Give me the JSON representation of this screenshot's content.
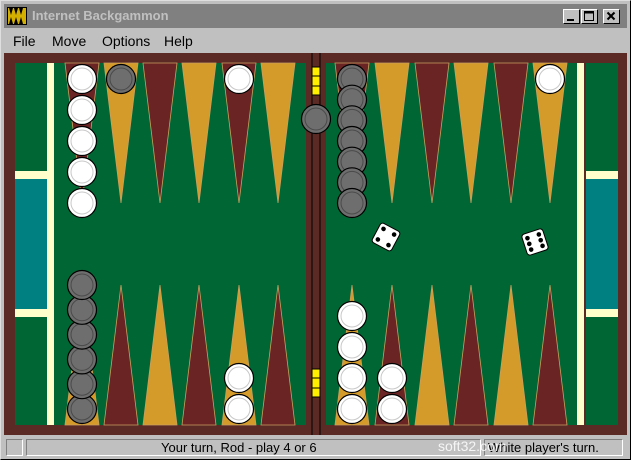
{
  "window": {
    "title": "Internet Backgammon",
    "controls": [
      "minimize",
      "maximize",
      "close"
    ]
  },
  "menu": [
    {
      "label": "File"
    },
    {
      "label": "Move"
    },
    {
      "label": "Options"
    },
    {
      "label": "Help"
    }
  ],
  "colors": {
    "felt": "#006633",
    "frame": "#5c2a25",
    "point_dark": "#6b2424",
    "point_light": "#d49a2a",
    "bear_off": "#008080",
    "bar": "#5c2a25",
    "white_checker": "#ffffff",
    "black_checker": "#6e6e6e",
    "trim": "#ffffcc"
  },
  "board": {
    "top_points": [
      {
        "white": 5,
        "black": 0
      },
      {
        "white": 0,
        "black": 1
      },
      {
        "white": 0,
        "black": 0
      },
      {
        "white": 0,
        "black": 0
      },
      {
        "white": 1,
        "black": 0
      },
      {
        "white": 0,
        "black": 0
      },
      {
        "white": 0,
        "black": 7
      },
      {
        "white": 0,
        "black": 0
      },
      {
        "white": 0,
        "black": 0
      },
      {
        "white": 0,
        "black": 0
      },
      {
        "white": 0,
        "black": 0
      },
      {
        "white": 1,
        "black": 0
      }
    ],
    "bottom_points": [
      {
        "white": 0,
        "black": 6
      },
      {
        "white": 0,
        "black": 0
      },
      {
        "white": 0,
        "black": 0
      },
      {
        "white": 0,
        "black": 0
      },
      {
        "white": 2,
        "black": 0
      },
      {
        "white": 0,
        "black": 0
      },
      {
        "white": 4,
        "black": 0
      },
      {
        "white": 2,
        "black": 0
      },
      {
        "white": 0,
        "black": 0
      },
      {
        "white": 0,
        "black": 0
      },
      {
        "white": 0,
        "black": 0
      },
      {
        "white": 0,
        "black": 0
      }
    ],
    "bar_checkers": {
      "black": 1,
      "white": 0
    },
    "dice": [
      4,
      6
    ]
  },
  "status": {
    "left": "",
    "message": "Your turn, Rod   - play 4 or 6",
    "turn": "White player's turn."
  },
  "watermark": "soft32.com"
}
